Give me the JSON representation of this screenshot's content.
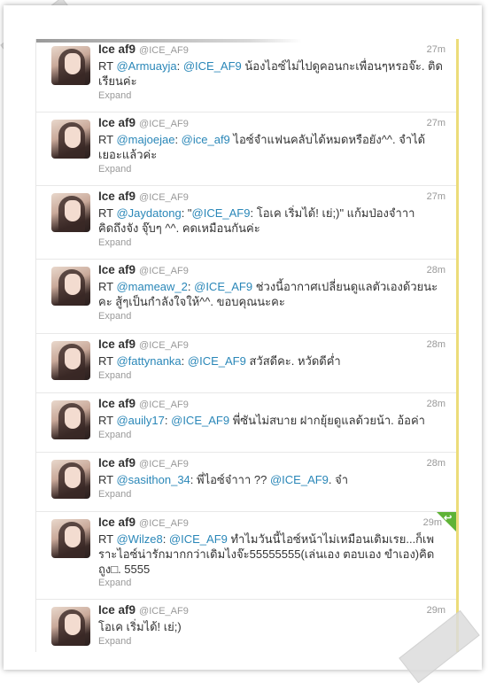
{
  "tweets": [
    {
      "name": "Ice af9",
      "handle": "@ICE_AF9",
      "time": "27m",
      "rt": "RT ",
      "m1": "@Armuayja",
      "m1s": ": ",
      "m2": "@ICE_AF9",
      "rest": " น้องไอซ์ไม่ไปดูคอนกะเพื่อนๆหรอจ๊ะ. ติดเรียนค่ะ",
      "expand": "Expand"
    },
    {
      "name": "Ice af9",
      "handle": "@ICE_AF9",
      "time": "27m",
      "rt": "RT ",
      "m1": "@majoejae",
      "m1s": ": ",
      "m2": "@ice_af9",
      "rest": " ไอซ์จำแฟนคลับได้หมดหรือยัง^^. จำได้เยอะแล้วค่ะ",
      "expand": "Expand"
    },
    {
      "name": "Ice af9",
      "handle": "@ICE_AF9",
      "time": "27m",
      "rt": "RT ",
      "m1": "@Jaydatong",
      "m1s": ": \"",
      "m2": "@ICE_AF9",
      "rest": ": โอเค เริ่มได้! เย่;)\" แก้มป่องจำาา คิดถึงจัง จุ๊บๆ ^^. คดเหมือนกันค่ะ",
      "expand": "Expand"
    },
    {
      "name": "Ice af9",
      "handle": "@ICE_AF9",
      "time": "28m",
      "rt": "RT ",
      "m1": "@mameaw_2",
      "m1s": ": ",
      "m2": "@ICE_AF9",
      "rest": " ช่วงนี้อากาศเปลี่ยนดูแลตัวเองด้วยนะคะ สู้ๆเป็นกำลังใจให้^^. ขอบคุณนะคะ",
      "expand": "Expand"
    },
    {
      "name": "Ice af9",
      "handle": "@ICE_AF9",
      "time": "28m",
      "rt": "RT ",
      "m1": "@fattynanka",
      "m1s": ": ",
      "m2": "@ICE_AF9",
      "rest": " สวัสดีคะ. หวัดดีค่ำ",
      "expand": "Expand"
    },
    {
      "name": "Ice af9",
      "handle": "@ICE_AF9",
      "time": "28m",
      "rt": "RT ",
      "m1": "@auily17",
      "m1s": ": ",
      "m2": "@ICE_AF9",
      "rest": " พี่ซันไม่สบาย ฝากยุ้ยดูแลด้วยน้า. อ้อค่า",
      "expand": "Expand"
    },
    {
      "name": "Ice af9",
      "handle": "@ICE_AF9",
      "time": "28m",
      "rt": "RT ",
      "m1": "@sasithon_34",
      "m1s": ": พี่ไอซ์จ๋าาา ?? ",
      "m2": "@ICE_AF9",
      "rest": ". จ๋า",
      "expand": "Expand"
    },
    {
      "name": "Ice af9",
      "handle": "@ICE_AF9",
      "time": "29m",
      "rt": "RT ",
      "m1": "@Wilze8",
      "m1s": ": ",
      "m2": "@ICE_AF9",
      "rest": " ทำไมวันนี้ไอซ์หน้าไม่เหมือนเดิมเรย...ก็เพราะไอซ์น่ารักมากกว่าเดิมไงจ๊ะ55555555(เล่นเอง ตอบเอง ขำเอง)คิดถูง□. 5555",
      "expand": "Expand"
    },
    {
      "name": "Ice af9",
      "handle": "@ICE_AF9",
      "time": "29m",
      "rt": "",
      "m1": "",
      "m1s": "",
      "m2": "",
      "rest": "โอเค เริ่มได้! เย่;)",
      "expand": "Expand"
    }
  ]
}
